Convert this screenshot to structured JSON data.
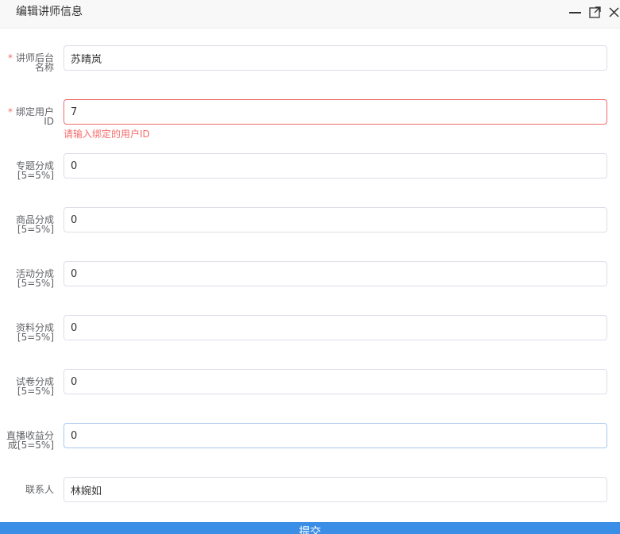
{
  "dialog": {
    "title": "编辑讲师信息"
  },
  "form": {
    "required_mark": "*",
    "fields": [
      {
        "label_line1": "讲师后台",
        "label_line2": "名称",
        "value": "苏晴岚",
        "required": true
      },
      {
        "label_line1": "绑定用户",
        "label_line2": "ID",
        "value": "7",
        "required": true,
        "error": "请输入绑定的用户ID"
      },
      {
        "label_line1": "专题分成",
        "label_line2": "[5=5%]",
        "value": "0"
      },
      {
        "label_line1": "商品分成",
        "label_line2": "[5=5%]",
        "value": "0"
      },
      {
        "label_line1": "活动分成",
        "label_line2": "[5=5%]",
        "value": "0"
      },
      {
        "label_line1": "资料分成",
        "label_line2": "[5=5%]",
        "value": "0"
      },
      {
        "label_line1": "试卷分成",
        "label_line2": "[5=5%]",
        "value": "0"
      },
      {
        "label_line1": "直播收益分",
        "label_line2": "成[5=5%]",
        "value": "0"
      },
      {
        "label_line1": "联系人",
        "label_line2": "",
        "value": "林婉如"
      }
    ]
  },
  "submit": {
    "label": "提交"
  },
  "colors": {
    "accent": "#3a8ee6",
    "error": "#f56c6c"
  }
}
